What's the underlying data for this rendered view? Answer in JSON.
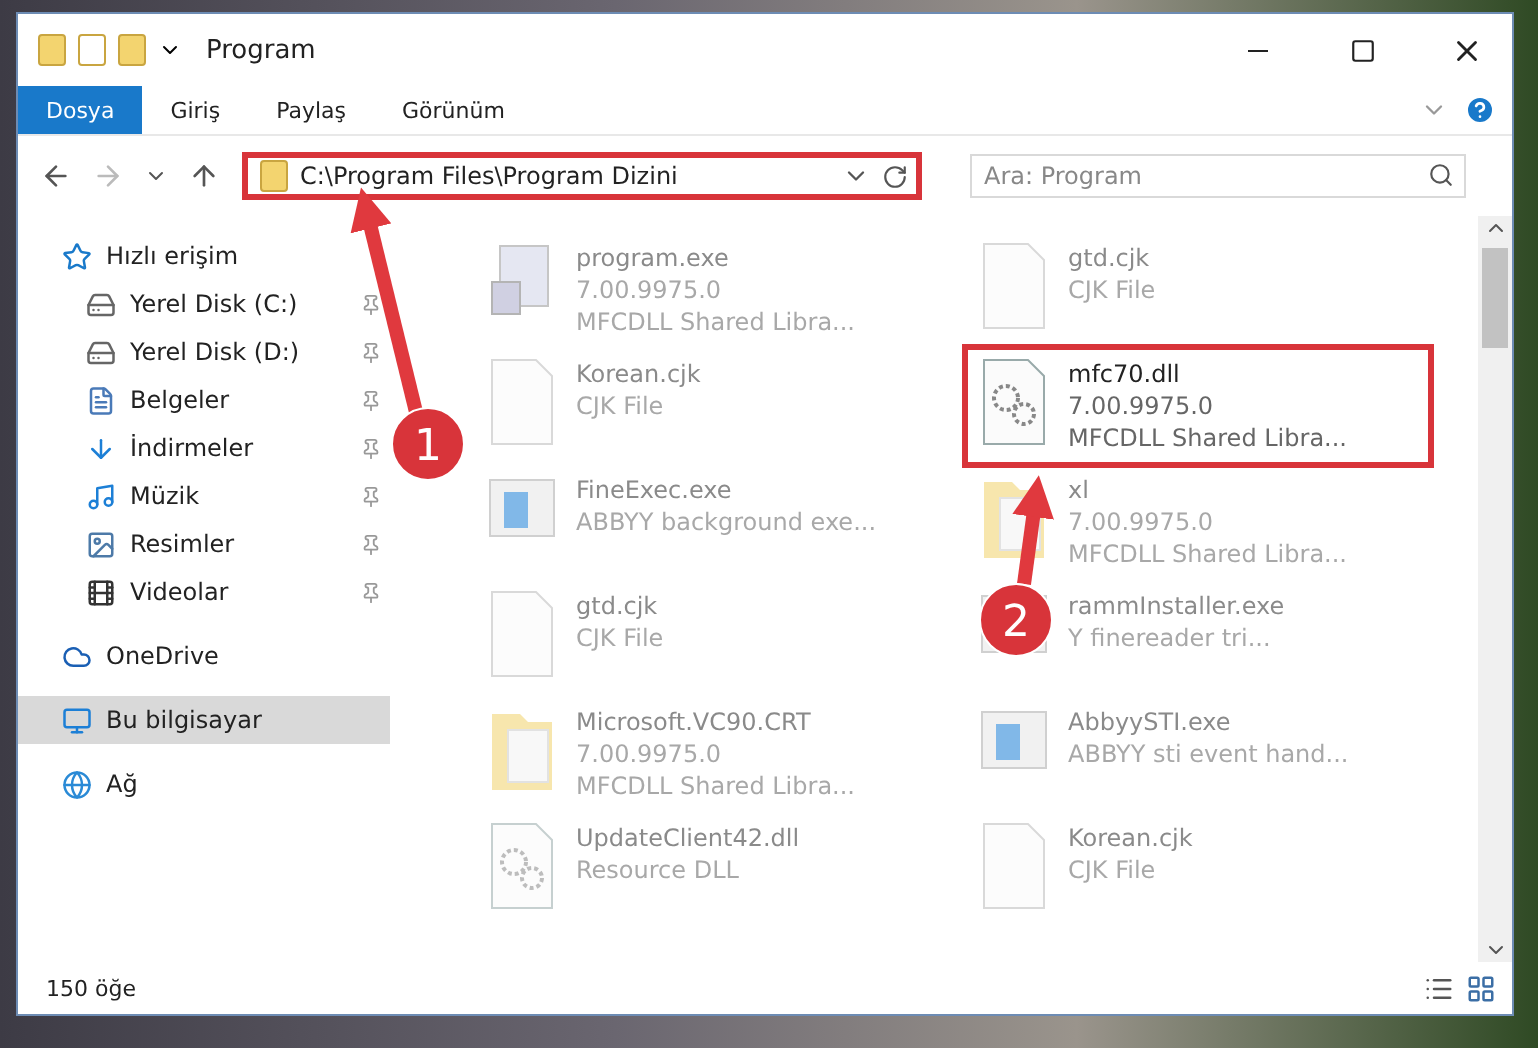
{
  "window": {
    "title": "Program"
  },
  "ribbon_tabs": [
    {
      "label": "Dosya",
      "selected": true
    },
    {
      "label": "Giriş",
      "selected": false
    },
    {
      "label": "Paylaş",
      "selected": false
    },
    {
      "label": "Görünüm",
      "selected": false
    }
  ],
  "address": {
    "path": "C:\\Program Files\\Program Dizini",
    "highlighted": true
  },
  "search": {
    "placeholder": "Ara: Program"
  },
  "sidebar": {
    "items": [
      {
        "label": "Hızlı erişim",
        "selected": false,
        "pinned": false,
        "children": [
          {
            "label": "Yerel Disk (C:)",
            "selected": false,
            "pinned": true
          },
          {
            "label": "Yerel Disk (D:)",
            "selected": false,
            "pinned": true
          },
          {
            "label": "Belgeler",
            "selected": false,
            "pinned": true
          },
          {
            "label": "İndirmeler",
            "selected": false,
            "pinned": true
          },
          {
            "label": "Müzik",
            "selected": false,
            "pinned": true
          },
          {
            "label": "Resimler",
            "selected": false,
            "pinned": true
          },
          {
            "label": "Videolar",
            "selected": false,
            "pinned": true
          }
        ]
      },
      {
        "label": "OneDrive",
        "selected": false,
        "pinned": false
      },
      {
        "label": "Bu bilgisayar",
        "selected": true,
        "pinned": false
      },
      {
        "label": "Ağ",
        "selected": false,
        "pinned": false
      }
    ]
  },
  "files": [
    {
      "kind": "exe",
      "name": "program.exe",
      "lines": [
        "7.00.9975.0",
        "MFCDLL Shared Libra..."
      ],
      "blurred": true,
      "highlighted": false
    },
    {
      "kind": "doc",
      "name": "gtd.cjk",
      "lines": [
        "CJK File"
      ],
      "blurred": true,
      "highlighted": false
    },
    {
      "kind": "doc",
      "name": "Korean.cjk",
      "lines": [
        "CJK File"
      ],
      "blurred": true,
      "highlighted": false
    },
    {
      "kind": "dll",
      "name": "mfc70.dll",
      "lines": [
        "7.00.9975.0",
        "MFCDLL Shared Libra..."
      ],
      "blurred": false,
      "highlighted": true
    },
    {
      "kind": "app",
      "name": "FineExec.exe",
      "lines": [
        "ABBYY background exe..."
      ],
      "blurred": true,
      "highlighted": false
    },
    {
      "kind": "folder",
      "name": "xl",
      "lines": [
        "7.00.9975.0",
        "MFCDLL Shared Libra..."
      ],
      "blurred": true,
      "highlighted": false
    },
    {
      "kind": "doc",
      "name": "gtd.cjk",
      "lines": [
        "CJK File"
      ],
      "blurred": true,
      "highlighted": false
    },
    {
      "kind": "app",
      "name": "rammInstaller.exe",
      "lines": [
        "Y finereader tri..."
      ],
      "blurred": true,
      "highlighted": false
    },
    {
      "kind": "folder",
      "name": "Microsoft.VC90.CRT",
      "lines": [
        "7.00.9975.0",
        "MFCDLL Shared Libra..."
      ],
      "blurred": true,
      "highlighted": false
    },
    {
      "kind": "app",
      "name": "AbbyySTI.exe",
      "lines": [
        "ABBYY sti event hand..."
      ],
      "blurred": true,
      "highlighted": false
    },
    {
      "kind": "dll",
      "name": "UpdateClient42.dll",
      "lines": [
        "Resource DLL"
      ],
      "blurred": true,
      "highlighted": false
    },
    {
      "kind": "doc",
      "name": "Korean.cjk",
      "lines": [
        "CJK File"
      ],
      "blurred": true,
      "highlighted": false
    }
  ],
  "status_bar": {
    "count": "150 öğe"
  },
  "annotations": [
    {
      "label": "1"
    },
    {
      "label": "2"
    }
  ]
}
